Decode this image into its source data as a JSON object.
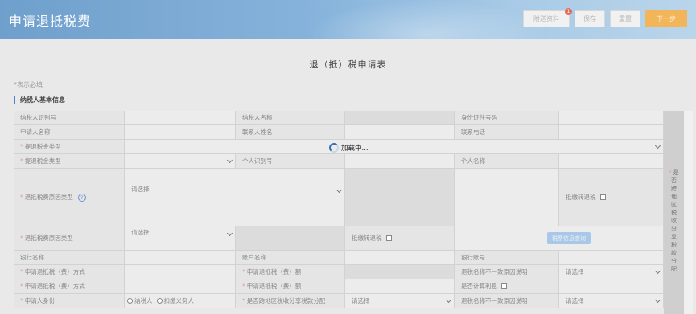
{
  "header": {
    "title": "申请退抵税费",
    "badge_count": "1",
    "buttons": {
      "attachments": "附送资料",
      "save": "保存",
      "reset": "重置",
      "next": "下一步"
    }
  },
  "form": {
    "title": "退（抵）税申请表",
    "required_note": "*表示必填",
    "section_title": "纳税人基本信息",
    "loading_text": "加载中..."
  },
  "labels": {
    "taxpayer_id": "纳税人识别号",
    "taxpayer_name": "纳税人名称",
    "id_doc_no": "身份证件号码",
    "applicant_name": "申请人名称",
    "contact_name": "联系人姓名",
    "contact_phone": "联系电话",
    "refund_type": "提退税金类型",
    "refund_type2": "提退税金类型",
    "personal_id": "个人识别号",
    "personal_name": "个人名称",
    "refund_reason_type": "退抵税费原因类型",
    "offset_tax": "抵缴转退税",
    "refund_reason_type2": "退抵税费原因类型",
    "offset_tax2": "抵缴转退税",
    "bank_name": "银行名称",
    "account_name": "账户名称",
    "bank_account": "银行账号",
    "refund_method": "申请退抵税（费）方式",
    "refund_amount": "申请退抵税（费）额",
    "name_mismatch_reason": "退税名称不一致原因说明",
    "refund_method2": "申请退抵税（费）方式",
    "refund_amount2": "申请退抵税（费）额",
    "calc_interest": "是否计算利息",
    "applicant_identity": "申请人身份",
    "regional_share": "是否跨地区税收分享税款分配",
    "name_mismatch_reason2": "退税名称不一致原因说明",
    "sidebar_vertical": "是否跨地区税收分享税款分配",
    "tax_source_query": "税票信息查询"
  },
  "selects": {
    "placeholder": "请选择"
  },
  "radios": {
    "taxpayer": "纳税人",
    "withholding_agent": "扣缴义务人"
  }
}
